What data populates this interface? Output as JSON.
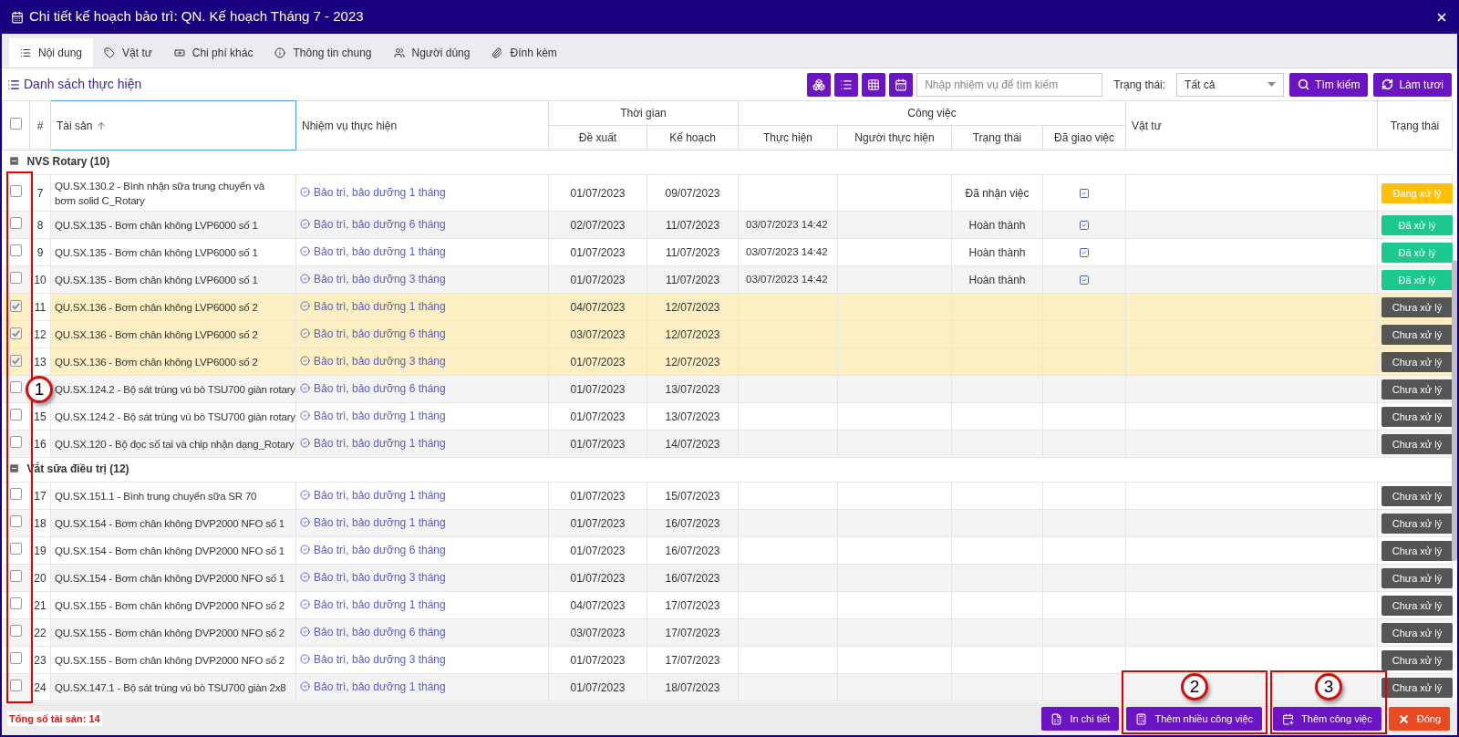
{
  "window": {
    "title": "Chi tiết kế hoạch bảo trì: QN. Kế hoạch Tháng 7 - 2023"
  },
  "tabs": [
    {
      "label": "Nội dung",
      "selected": true,
      "kind": "list"
    },
    {
      "label": "Vật tư",
      "selected": false,
      "kind": "tag"
    },
    {
      "label": "Chi phí khác",
      "selected": false,
      "kind": "money"
    },
    {
      "label": "Thông tin chung",
      "selected": false,
      "kind": "info"
    },
    {
      "label": "Người dùng",
      "selected": false,
      "kind": "users"
    },
    {
      "label": "Đính kèm",
      "selected": false,
      "kind": "attach"
    }
  ],
  "toolbar": {
    "title": "Danh sách thực hiện",
    "search": {
      "placeholder": "Nhập nhiệm vụ để tìm kiếm"
    },
    "status_label": "Trạng thái:",
    "status_value": "Tất cả",
    "buttons": [
      {
        "label": "Tìm kiếm",
        "kind": "search"
      },
      {
        "label": "Làm tươi",
        "kind": "refresh"
      }
    ]
  },
  "table": {
    "select_all": {
      "checked": false
    },
    "header": {
      "number": "#",
      "asset": "Tài sản",
      "task": "Nhiệm vụ thực hiện",
      "time": "Thời gian",
      "proposed": "Đề xuất",
      "planned": "Kế hoạch",
      "work": "Công việc",
      "done": "Thực hiện",
      "person": "Người thực hiện",
      "status": "Trạng thái",
      "assigned": "Đã giao việc",
      "material": "Vật tư",
      "state": "Trạng thái"
    },
    "groups": [
      {
        "title": "NVS Rotary (10)",
        "rows": [
          {
            "num": "7",
            "asset": "QU.SX.130.2 - Bình nhận sữa trung chuyển và bơm solid C_Rotary",
            "task": "Bảo trì, bảo dưỡng 1 tháng",
            "proposed": "01/07/2023",
            "planned": "09/07/2023",
            "status": "Đã nhận việc",
            "assigned": true,
            "badge": "Đang xử lý",
            "color": "#ffc107",
            "checked": false
          },
          {
            "num": "8",
            "asset": "QU.SX.135 - Bơm chân không LVP6000 số 1",
            "task": "Bảo trì, bảo dưỡng 6 tháng",
            "proposed": "02/07/2023",
            "planned": "11/07/2023",
            "done": "03/07/2023 14:42",
            "status": "Hoàn thành",
            "assigned": true,
            "badge": "Đã xử lý",
            "color": "#1bc98e",
            "checked": false
          },
          {
            "num": "9",
            "asset": "QU.SX.135 - Bơm chân không LVP6000 số 1",
            "task": "Bảo trì, bảo dưỡng 1 tháng",
            "proposed": "01/07/2023",
            "planned": "11/07/2023",
            "done": "03/07/2023 14:42",
            "status": "Hoàn thành",
            "assigned": true,
            "badge": "Đã xử lý",
            "color": "#1bc98e",
            "checked": false
          },
          {
            "num": "10",
            "asset": "QU.SX.135 - Bơm chân không LVP6000 số 1",
            "task": "Bảo trì, bảo dưỡng 3 tháng",
            "proposed": "01/07/2023",
            "planned": "11/07/2023",
            "done": "03/07/2023 14:42",
            "status": "Hoàn thành",
            "assigned": true,
            "badge": "Đã xử lý",
            "color": "#1bc98e",
            "checked": false
          },
          {
            "num": "11",
            "asset": "QU.SX.136 - Bơm chân không LVP6000 số 2",
            "task": "Bảo trì, bảo dưỡng 1 tháng",
            "proposed": "04/07/2023",
            "planned": "12/07/2023",
            "assigned": false,
            "badge": "Chưa xử lý",
            "color": "#555555",
            "checked": true
          },
          {
            "num": "12",
            "asset": "QU.SX.136 - Bơm chân không LVP6000 số 2",
            "task": "Bảo trì, bảo dưỡng 6 tháng",
            "proposed": "03/07/2023",
            "planned": "12/07/2023",
            "assigned": false,
            "badge": "Chưa xử lý",
            "color": "#555555",
            "checked": true
          },
          {
            "num": "13",
            "asset": "QU.SX.136 - Bơm chân không LVP6000 số 2",
            "task": "Bảo trì, bảo dưỡng 3 tháng",
            "proposed": "01/07/2023",
            "planned": "12/07/2023",
            "assigned": false,
            "badge": "Chưa xử lý",
            "color": "#555555",
            "checked": true
          },
          {
            "asset": "QU.SX.124.2 - Bộ sát trùng vú bò TSU700 giàn rotary",
            "task": "Bảo trì, bảo dưỡng 6 tháng",
            "proposed": "01/07/2023",
            "planned": "13/07/2023",
            "assigned": false,
            "badge": "Chưa xử lý",
            "color": "#555555",
            "checked": false
          },
          {
            "num": "15",
            "asset": "QU.SX.124.2 - Bộ sát trùng vú bò TSU700 giàn rotary",
            "task": "Bảo trì, bảo dưỡng 1 tháng",
            "proposed": "01/07/2023",
            "planned": "13/07/2023",
            "assigned": false,
            "badge": "Chưa xử lý",
            "color": "#555555",
            "checked": false
          },
          {
            "num": "16",
            "asset": "QU.SX.120 - Bộ đọc số tai và chip nhận dạng_Rotary",
            "task": "Bảo trì, bảo dưỡng 1 tháng",
            "proposed": "01/07/2023",
            "planned": "14/07/2023",
            "assigned": false,
            "badge": "Chưa xử lý",
            "color": "#555555",
            "checked": false
          }
        ]
      },
      {
        "title": "Vắt sữa điều trị (12)",
        "rows": [
          {
            "num": "17",
            "asset": "QU.SX.151.1 - Bình trung chuyển sữa SR 70",
            "task": "Bảo trì, bảo dưỡng 1 tháng",
            "proposed": "01/07/2023",
            "planned": "15/07/2023",
            "assigned": false,
            "badge": "Chưa xử lý",
            "color": "#555555",
            "checked": false
          },
          {
            "num": "18",
            "asset": "QU.SX.154 - Bơm chân không DVP2000 NFO số 1",
            "task": "Bảo trì, bảo dưỡng 1 tháng",
            "proposed": "01/07/2023",
            "planned": "16/07/2023",
            "assigned": false,
            "badge": "Chưa xử lý",
            "color": "#555555",
            "checked": false
          },
          {
            "num": "19",
            "asset": "QU.SX.154 - Bơm chân không DVP2000 NFO số 1",
            "task": "Bảo trì, bảo dưỡng 6 tháng",
            "proposed": "01/07/2023",
            "planned": "16/07/2023",
            "assigned": false,
            "badge": "Chưa xử lý",
            "color": "#555555",
            "checked": false
          },
          {
            "num": "20",
            "asset": "QU.SX.154 - Bơm chân không DVP2000 NFO số 1",
            "task": "Bảo trì, bảo dưỡng 3 tháng",
            "proposed": "01/07/2023",
            "planned": "16/07/2023",
            "assigned": false,
            "badge": "Chưa xử lý",
            "color": "#555555",
            "checked": false
          },
          {
            "num": "21",
            "asset": "QU.SX.155 - Bơm chân không DVP2000 NFO số 2",
            "task": "Bảo trì, bảo dưỡng 1 tháng",
            "proposed": "04/07/2023",
            "planned": "17/07/2023",
            "assigned": false,
            "badge": "Chưa xử lý",
            "color": "#555555",
            "checked": false
          },
          {
            "num": "22",
            "asset": "QU.SX.155 - Bơm chân không DVP2000 NFO số 2",
            "task": "Bảo trì, bảo dưỡng 6 tháng",
            "proposed": "03/07/2023",
            "planned": "17/07/2023",
            "assigned": false,
            "badge": "Chưa xử lý",
            "color": "#555555",
            "checked": false
          },
          {
            "num": "23",
            "asset": "QU.SX.155 - Bơm chân không DVP2000 NFO số 2",
            "task": "Bảo trì, bảo dưỡng 3 tháng",
            "proposed": "01/07/2023",
            "planned": "17/07/2023",
            "assigned": false,
            "badge": "Chưa xử lý",
            "color": "#555555",
            "checked": false
          },
          {
            "num": "24",
            "asset": "QU.SX.147.1 - Bộ sát trùng vú bò TSU700 giàn 2x8",
            "task": "Bảo trì, bảo dưỡng 1 tháng",
            "proposed": "01/07/2023",
            "planned": "18/07/2023",
            "assigned": false,
            "badge": "Chưa xử lý",
            "color": "#555555",
            "checked": false
          }
        ]
      }
    ]
  },
  "footer": {
    "total": "Tổng số tài sản: 14",
    "buttons": [
      {
        "label": "In chi tiết",
        "kind": "print"
      },
      {
        "label": "Thêm nhiều công việc",
        "kind": "multi"
      },
      {
        "label": "Thêm công việc",
        "kind": "add"
      },
      {
        "label": "Đóng",
        "kind": "close"
      }
    ]
  },
  "annotations": [
    {
      "label": "1"
    },
    {
      "label": "2"
    },
    {
      "label": "3"
    }
  ]
}
